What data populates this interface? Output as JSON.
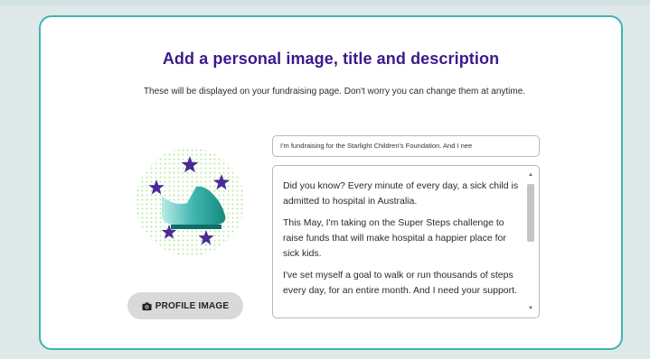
{
  "card": {
    "title": "Add a personal image, title and description",
    "subtitle": "These will be displayed on your fundraising page. Don't worry you can change them at anytime."
  },
  "profile_button": {
    "label": "PROFILE IMAGE",
    "icon": "camera-icon"
  },
  "title_input": {
    "value": "I'm fundraising for the Starlight Children's Foundation. And I nee"
  },
  "description": {
    "paragraphs": [
      "Did you know? Every minute of every day, a sick child is admitted to hospital in Australia.",
      "This May, I'm taking on the Super Steps challenge to raise funds that will make hospital a happier place for sick kids.",
      "I've set myself a goal to walk or run thousands of steps every day, for an entire month. And I need your support."
    ]
  },
  "colors": {
    "title": "#3a1a8c",
    "card_border": "#3fb5ae",
    "star": "#4a2b96",
    "shoe": "#1f9b8f",
    "dots": "#9be07a",
    "background": "#dfe9ea"
  }
}
